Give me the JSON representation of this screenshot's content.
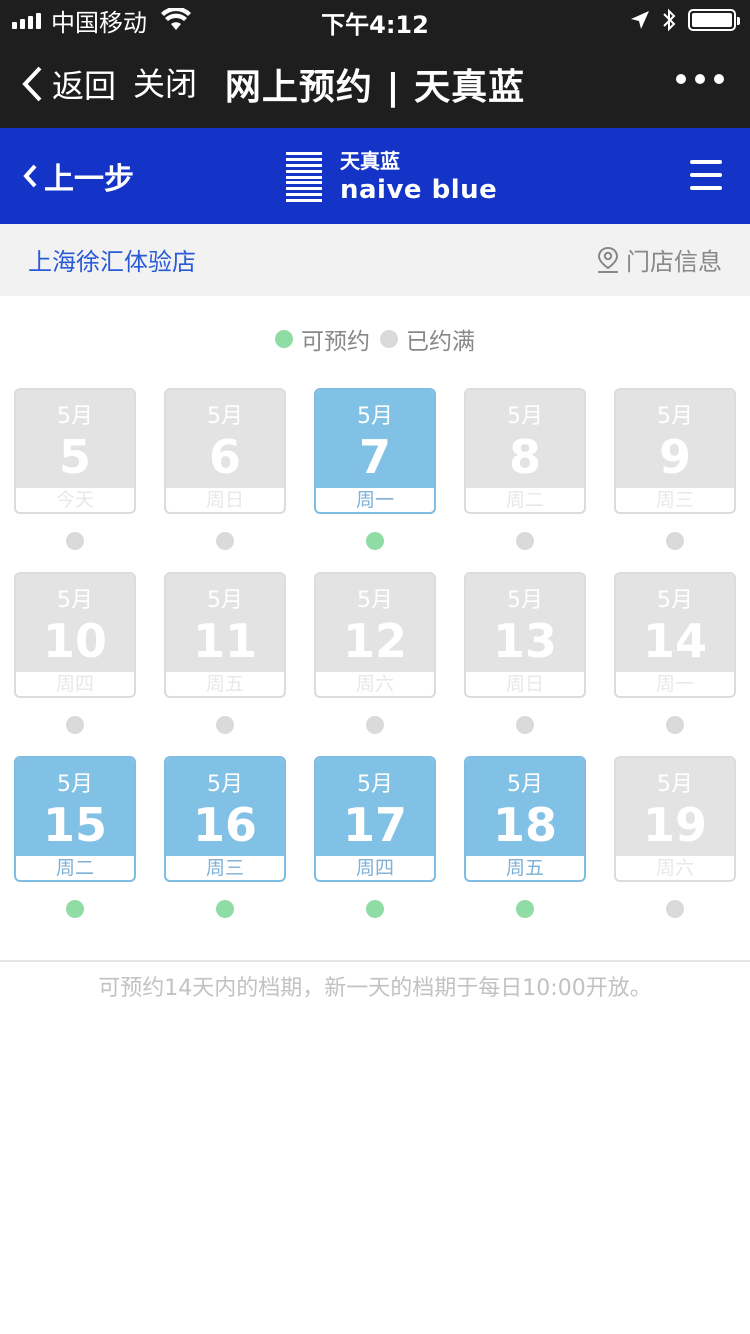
{
  "status_bar": {
    "carrier": "中国移动",
    "time": "下午4:12"
  },
  "nav": {
    "back_label": "返回",
    "close_label": "关闭",
    "title": "网上预约 | 天真蓝"
  },
  "brand": {
    "prev_step": "上一步",
    "name_cn": "天真蓝",
    "name_en": "naive blue"
  },
  "store": {
    "name": "上海徐汇体验店",
    "info_label": "门店信息"
  },
  "legend": {
    "available": "可预约",
    "full": "已约满"
  },
  "colors": {
    "available_cell": "#82c1e6",
    "full_cell": "#e3e3e3",
    "available_dot": "#8fdca5",
    "full_dot": "#dadada",
    "brand_blue": "#1434c8"
  },
  "days": [
    {
      "month": "5月",
      "day": "5",
      "weekday": "今天",
      "available": false
    },
    {
      "month": "5月",
      "day": "6",
      "weekday": "周日",
      "available": false
    },
    {
      "month": "5月",
      "day": "7",
      "weekday": "周一",
      "available": true
    },
    {
      "month": "5月",
      "day": "8",
      "weekday": "周二",
      "available": false
    },
    {
      "month": "5月",
      "day": "9",
      "weekday": "周三",
      "available": false
    },
    {
      "month": "5月",
      "day": "10",
      "weekday": "周四",
      "available": false
    },
    {
      "month": "5月",
      "day": "11",
      "weekday": "周五",
      "available": false
    },
    {
      "month": "5月",
      "day": "12",
      "weekday": "周六",
      "available": false
    },
    {
      "month": "5月",
      "day": "13",
      "weekday": "周日",
      "available": false
    },
    {
      "month": "5月",
      "day": "14",
      "weekday": "周一",
      "available": false
    },
    {
      "month": "5月",
      "day": "15",
      "weekday": "周二",
      "available": true
    },
    {
      "month": "5月",
      "day": "16",
      "weekday": "周三",
      "available": true
    },
    {
      "month": "5月",
      "day": "17",
      "weekday": "周四",
      "available": true
    },
    {
      "month": "5月",
      "day": "18",
      "weekday": "周五",
      "available": true
    },
    {
      "month": "5月",
      "day": "19",
      "weekday": "周六",
      "available": false
    }
  ],
  "footer_note": "可预约14天内的档期，新一天的档期于每日10:00开放。"
}
